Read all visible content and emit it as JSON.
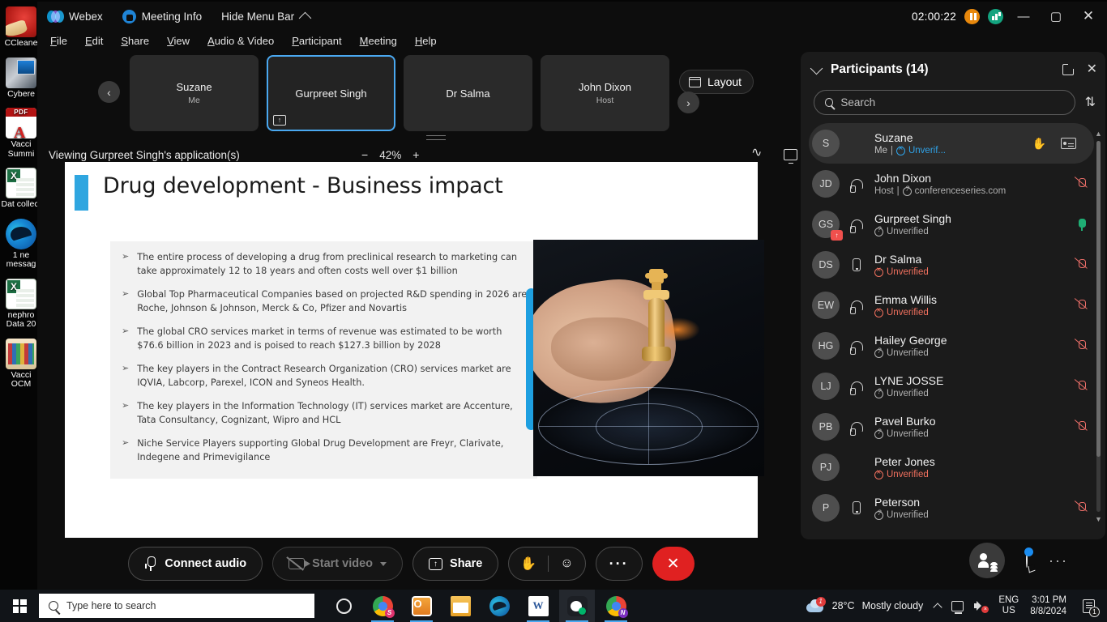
{
  "desktop": {
    "icons": [
      {
        "label": "CCleane",
        "glyph": "ccleaner-icon"
      },
      {
        "label": "Cybere",
        "glyph": "cybereason-icon"
      },
      {
        "label": "Vacci Summi",
        "glyph": "pdf-icon"
      },
      {
        "label": "Dat collect",
        "glyph": "excel-icon"
      },
      {
        "label": "1 ne messag",
        "glyph": "edge-icon"
      },
      {
        "label": "nephro Data 20",
        "glyph": "excel-icon"
      },
      {
        "label": "Vacci OCM",
        "glyph": "zip-icon"
      }
    ]
  },
  "window": {
    "app_name": "Webex",
    "meeting_info_label": "Meeting Info",
    "hide_menu_label": "Hide Menu Bar",
    "timer": "02:00:22",
    "menu": [
      "File",
      "Edit",
      "Share",
      "View",
      "Audio & Video",
      "Participant",
      "Meeting",
      "Help"
    ],
    "controls": {
      "minimize": "—",
      "maximize": "▢",
      "close": "✕"
    }
  },
  "strip": {
    "tiles": [
      {
        "name": "Suzane",
        "sub": "Me",
        "active": false,
        "sharing": false
      },
      {
        "name": "Gurpreet Singh",
        "sub": "",
        "active": true,
        "sharing": true
      },
      {
        "name": "Dr Salma",
        "sub": "",
        "active": false,
        "sharing": false
      },
      {
        "name": "John Dixon",
        "sub": "Host",
        "active": false,
        "sharing": false
      }
    ],
    "layout_label": "Layout",
    "prev_arrow": "‹",
    "next_arrow": "›"
  },
  "viewbar": {
    "viewing_text": "Viewing Gurpreet Singh's application(s)",
    "zoom_out": "−",
    "zoom_value": "42%",
    "zoom_in": "+"
  },
  "slide": {
    "title": "Drug development - Business impact",
    "bullets": [
      "The entire process of developing a drug from preclinical research to marketing can take approximately 12 to 18 years and often costs well over $1 billion",
      "Global Top Pharmaceutical Companies based on projected R&D spending in 2026 are Roche, Johnson & Johnson, Merck & Co, Pfizer and Novartis",
      "The global CRO services market in terms of revenue was estimated to be worth $76.6 billion in 2023 and is poised to reach $127.3 billion by 2028",
      "The key players in the Contract Research Organization (CRO) services market are IQVIA, Labcorp, Parexel, ICON and Syneos Health.",
      "The key players in the Information Technology (IT) services market are Accenture, Tata Consultancy, Cognizant, Wipro and HCL",
      "Niche Service Players supporting Global Drug Development are Freyr, Clarivate, Indegene and Primevigilance"
    ],
    "accent_color": "#2fa6e0"
  },
  "controls": {
    "connect_audio": "Connect audio",
    "start_video": "Start video",
    "share": "Share",
    "more": "···",
    "hangup": "✕"
  },
  "panel": {
    "title": "Participants (14)",
    "search_placeholder": "Search",
    "participants": [
      {
        "initials": "S",
        "name": "Suzane",
        "role": "Me",
        "status": "Unverif...",
        "status_kind": "blue",
        "device": "none",
        "mic": "none",
        "me": true,
        "sharing": false
      },
      {
        "initials": "JD",
        "name": "John Dixon",
        "role": "Host",
        "status": "conferenceseries.com",
        "status_kind": "gray",
        "device": "headset",
        "mic": "muted",
        "me": false,
        "sharing": false
      },
      {
        "initials": "GS",
        "name": "Gurpreet Singh",
        "role": "",
        "status": "Unverified",
        "status_kind": "gray",
        "device": "headset",
        "mic": "on",
        "me": false,
        "sharing": true
      },
      {
        "initials": "DS",
        "name": "Dr Salma",
        "role": "",
        "status": "Unverified",
        "status_kind": "red",
        "device": "phone",
        "mic": "muted",
        "me": false,
        "sharing": false
      },
      {
        "initials": "EW",
        "name": "Emma Willis",
        "role": "",
        "status": "Unverified",
        "status_kind": "red",
        "device": "headset",
        "mic": "muted",
        "me": false,
        "sharing": false
      },
      {
        "initials": "HG",
        "name": "Hailey George",
        "role": "",
        "status": "Unverified",
        "status_kind": "gray",
        "device": "headset",
        "mic": "muted",
        "me": false,
        "sharing": false
      },
      {
        "initials": "LJ",
        "name": "LYNE JOSSE",
        "role": "",
        "status": "Unverified",
        "status_kind": "gray",
        "device": "headset",
        "mic": "muted",
        "me": false,
        "sharing": false
      },
      {
        "initials": "PB",
        "name": "Pavel Burko",
        "role": "",
        "status": "Unverified",
        "status_kind": "gray",
        "device": "headset",
        "mic": "muted",
        "me": false,
        "sharing": false
      },
      {
        "initials": "PJ",
        "name": "Peter Jones",
        "role": "",
        "status": "Unverified",
        "status_kind": "red",
        "device": "none",
        "mic": "none",
        "me": false,
        "sharing": false
      },
      {
        "initials": "P",
        "name": "Peterson",
        "role": "",
        "status": "Unverified",
        "status_kind": "gray",
        "device": "phone",
        "mic": "muted",
        "me": false,
        "sharing": false
      }
    ]
  },
  "taskbar": {
    "search_placeholder": "Type here to search",
    "temperature": "28°C",
    "weather": "Mostly cloudy",
    "lang_top": "ENG",
    "lang_bottom": "US",
    "time": "3:01 PM",
    "date": "8/8/2024",
    "notification_count": "1"
  }
}
